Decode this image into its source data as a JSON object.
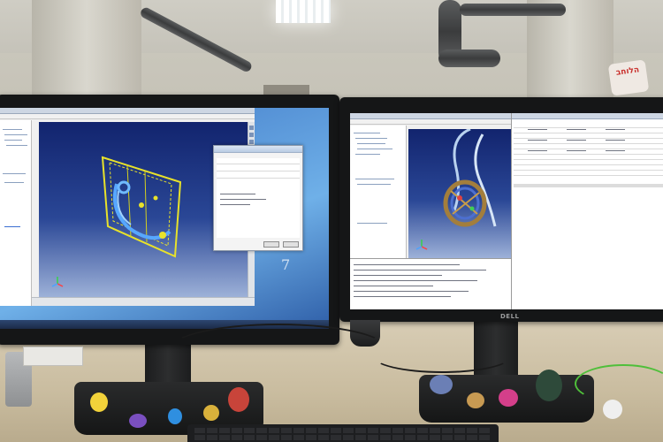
{
  "scene": {
    "description_text": "",
    "sign_text": "הלוחב",
    "left_monitor": {
      "brand": "",
      "desktop_watermark": "7"
    },
    "right_monitor": {
      "brand": "DELL"
    }
  },
  "colors": {
    "viewport_top": "#12246e",
    "viewport_bottom": "#9db1d8",
    "wireframe": "#e8e22a",
    "sign_text": "#c9302c",
    "green_cable": "#4fbf3a"
  }
}
